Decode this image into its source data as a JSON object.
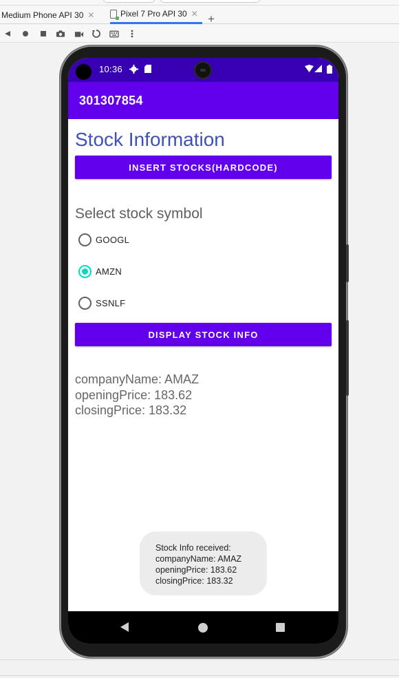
{
  "ide": {
    "tabs": [
      {
        "label": "Medium Phone API 30",
        "active": false
      },
      {
        "label": "Pixel 7 Pro API 30",
        "active": true
      }
    ],
    "new_tab_icon": "plus-icon",
    "toolbar_icons": [
      "back-triangle-icon",
      "home-circle-icon",
      "overview-square-icon",
      "camera-icon",
      "video-icon",
      "rotate-icon",
      "keyboard-icon",
      "more-vert-icon"
    ],
    "tab_accent": "#3574f0"
  },
  "status_bar": {
    "time": "10:36",
    "icons": [
      "gear-icon",
      "sd-card-icon",
      "wifi-icon",
      "signal-icon",
      "battery-icon"
    ],
    "color": "#3700b3"
  },
  "app_bar": {
    "title": "301307854",
    "color": "#6200ee"
  },
  "screen": {
    "heading": "Stock Information",
    "insert_button": "INSERT STOCKS(HARDCODE)",
    "select_label": "Select stock symbol",
    "radio_options": [
      {
        "label": "GOOGL",
        "checked": false
      },
      {
        "label": "AMZN",
        "checked": true
      },
      {
        "label": "SSNLF",
        "checked": false
      }
    ],
    "display_button": "DISPLAY STOCK INFO",
    "info": {
      "company": "companyName: AMAZ",
      "opening": "openingPrice: 183.62",
      "closing": "closingPrice: 183.32"
    },
    "toast": {
      "line1": "Stock Info received:",
      "line2": "companyName: AMAZ",
      "line3": "openingPrice: 183.62",
      "line4": "closingPrice: 183.32"
    },
    "accent_color": "#03dac5"
  }
}
